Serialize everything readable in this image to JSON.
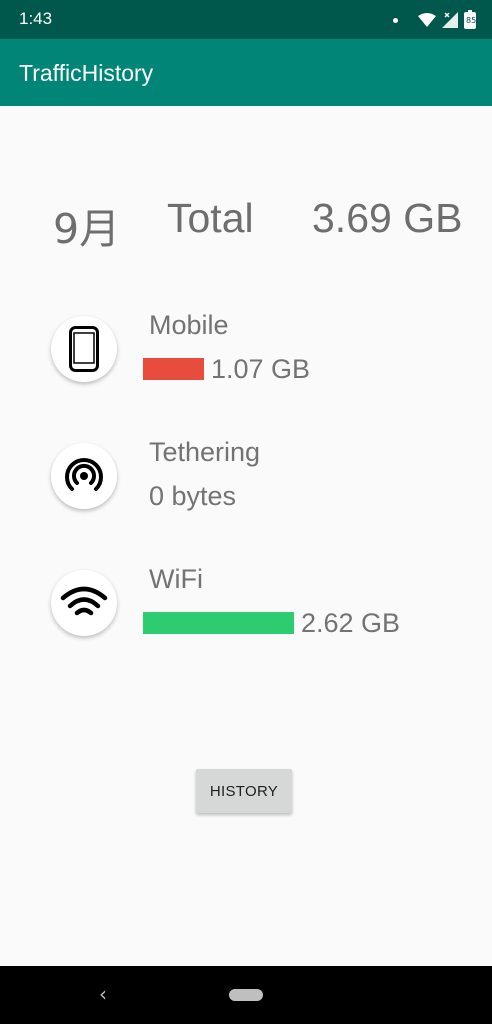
{
  "status_bar": {
    "time": "1:43",
    "battery_level": "85",
    "icons": [
      "notification-dot-icon",
      "wifi-icon",
      "signal-icon",
      "battery-icon"
    ]
  },
  "app_bar": {
    "title": "TrafficHistory"
  },
  "summary": {
    "month": "9月",
    "label": "Total",
    "total": "3.69 GB"
  },
  "usage": {
    "mobile": {
      "label": "Mobile",
      "value": "1.07 GB",
      "bar_color": "#e74c3c",
      "icon": "smartphone-icon"
    },
    "tethering": {
      "label": "Tethering",
      "value": "0 bytes",
      "icon": "tethering-hotspot-icon"
    },
    "wifi": {
      "label": "WiFi",
      "value": "2.62 GB",
      "bar_color": "#2ecc71",
      "icon": "wifi-icon"
    }
  },
  "actions": {
    "history_label": "HISTORY"
  },
  "colors": {
    "status_bar": "#00574b",
    "app_bar": "#008577",
    "background": "#fafafa"
  }
}
